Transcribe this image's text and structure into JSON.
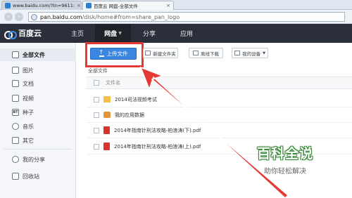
{
  "browser": {
    "tabs": [
      {
        "title": "www.baidu.com/?tn=9611:"
      },
      {
        "title": "百度云 网盘-全部文件"
      }
    ],
    "url_host": "pan.baidu.com",
    "url_path": "/disk/home#from=share_pan_logo"
  },
  "header": {
    "logo_text": "百度云",
    "nav": [
      {
        "label": "主页"
      },
      {
        "label": "网盘"
      },
      {
        "label": "分享"
      },
      {
        "label": "应用"
      }
    ]
  },
  "sidebar": {
    "items": [
      {
        "label": "全部文件",
        "icon": "file-icon"
      },
      {
        "label": "图片",
        "icon": "image-icon"
      },
      {
        "label": "文档",
        "icon": "document-icon"
      },
      {
        "label": "视频",
        "icon": "video-icon"
      },
      {
        "label": "种子",
        "icon": "bt-icon",
        "badge": "BT"
      },
      {
        "label": "音乐",
        "icon": "music-icon"
      },
      {
        "label": "其它",
        "icon": "other-icon"
      },
      {
        "label": "我的分享",
        "icon": "share-icon"
      },
      {
        "label": "回收站",
        "icon": "trash-icon"
      }
    ]
  },
  "toolbar": {
    "upload_label": "上传文件",
    "new_folder_label": "新建文件夹",
    "offline_download_label": "离线下载",
    "my_device_label": "我的设备"
  },
  "breadcrumb": "全部文件",
  "table": {
    "column_name": "文件名",
    "rows": [
      {
        "name": "2014司法视频考试",
        "type": "folder"
      },
      {
        "name": "我的应用数据",
        "type": "appdata"
      },
      {
        "name": "2014年指南针刑法攻略-柏浪涛(下).pdf",
        "type": "pdf"
      },
      {
        "name": "2014年指南针刑法攻略-柏浪涛(上).pdf",
        "type": "pdf"
      }
    ]
  },
  "watermark": {
    "title": "百科全说",
    "subtitle": "助你轻松解决"
  },
  "colors": {
    "header_bg": "#2b2f3a",
    "upload_blue": "#3a86e0",
    "highlight_red": "#e53935"
  }
}
